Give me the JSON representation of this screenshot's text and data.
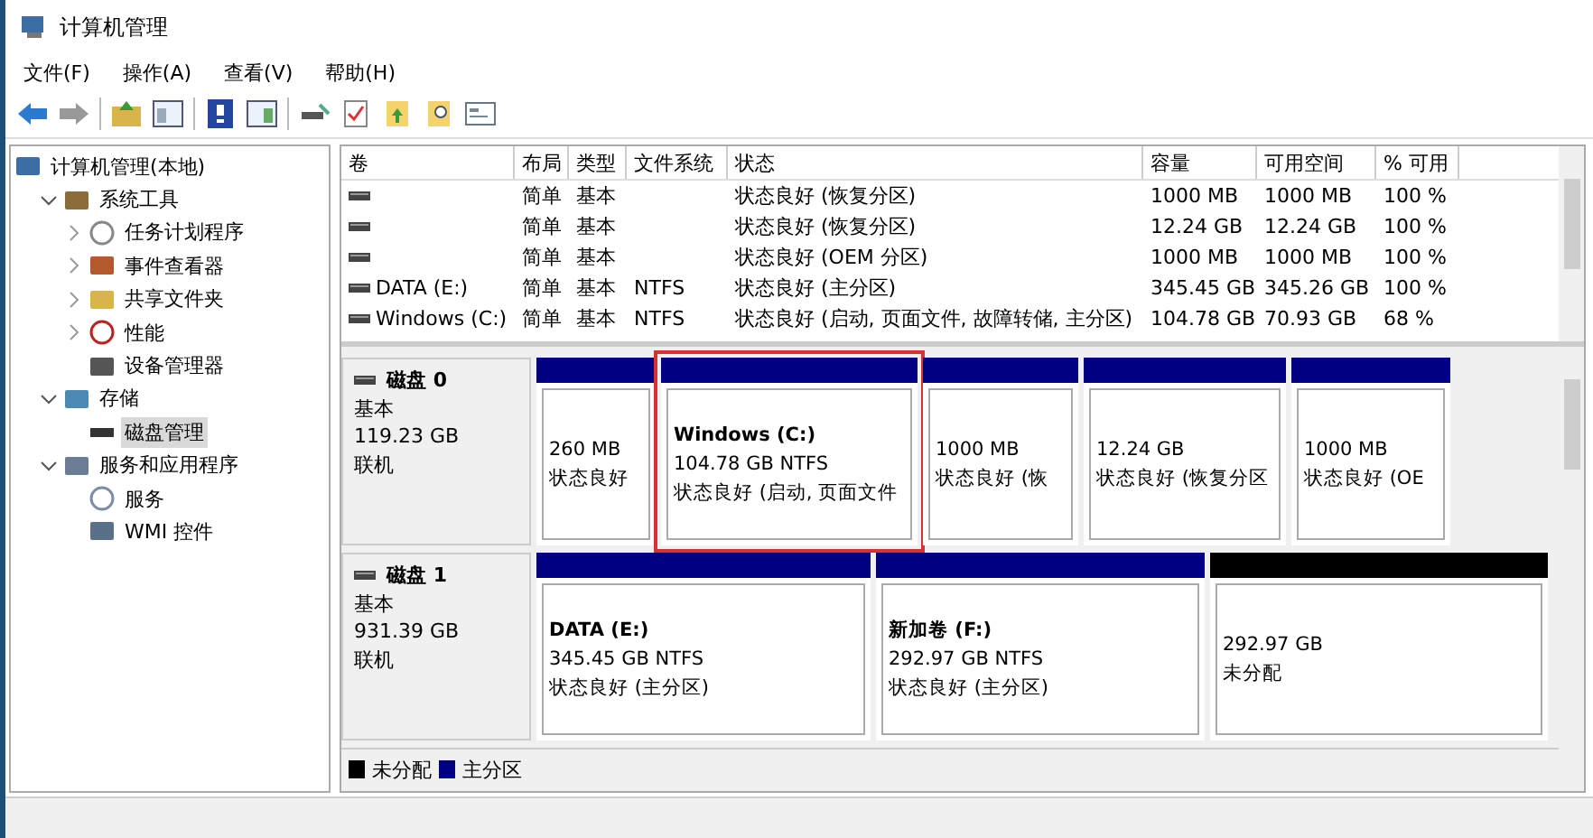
{
  "window": {
    "title": "计算机管理"
  },
  "menu": [
    "文件(F)",
    "操作(A)",
    "查看(V)",
    "帮助(H)"
  ],
  "tree": [
    {
      "label": "计算机管理(本地)",
      "selected": false,
      "children": [
        {
          "label": "系统工具",
          "expanded": true,
          "selected": false,
          "children": [
            {
              "label": "任务计划程序",
              "expanded": false,
              "selected": false
            },
            {
              "label": "事件查看器",
              "expanded": false,
              "selected": false
            },
            {
              "label": "共享文件夹",
              "expanded": false,
              "selected": false
            },
            {
              "label": "性能",
              "expanded": false,
              "selected": false
            },
            {
              "label": "设备管理器",
              "selected": false
            }
          ]
        },
        {
          "label": "存储",
          "expanded": true,
          "selected": false,
          "children": [
            {
              "label": "磁盘管理",
              "selected": true
            }
          ]
        },
        {
          "label": "服务和应用程序",
          "expanded": true,
          "selected": false,
          "children": [
            {
              "label": "服务",
              "selected": false
            },
            {
              "label": "WMI 控件",
              "selected": false
            }
          ]
        }
      ]
    }
  ],
  "table": {
    "columns": [
      "卷",
      "布局",
      "类型",
      "文件系统",
      "状态",
      "容量",
      "可用空间",
      "% 可用"
    ],
    "rows": [
      [
        "",
        "简单",
        "基本",
        "",
        "状态良好 (恢复分区)",
        "1000 MB",
        "1000 MB",
        "100 %"
      ],
      [
        "",
        "简单",
        "基本",
        "",
        "状态良好 (恢复分区)",
        "12.24 GB",
        "12.24 GB",
        "100 %"
      ],
      [
        "",
        "简单",
        "基本",
        "",
        "状态良好 (OEM 分区)",
        "1000 MB",
        "1000 MB",
        "100 %"
      ],
      [
        "DATA (E:)",
        "简单",
        "基本",
        "NTFS",
        "状态良好 (主分区)",
        "345.45 GB",
        "345.26 GB",
        "100 %"
      ],
      [
        "Windows (C:)",
        "简单",
        "基本",
        "NTFS",
        "状态良好 (启动, 页面文件, 故障转储, 主分区)",
        "104.78 GB",
        "70.93 GB",
        "68 %"
      ]
    ]
  },
  "disks": [
    {
      "name": "磁盘 0",
      "type": "基本",
      "size": "119.23 GB",
      "status": "联机",
      "partitions": [
        {
          "kind": "primary",
          "size": "260 MB",
          "status": "状态良好",
          "highlighted": false
        },
        {
          "kind": "primary",
          "name": "Windows  (C:)",
          "size": "104.78 GB NTFS",
          "status": "状态良好 (启动, 页面文件",
          "highlighted": true
        },
        {
          "kind": "primary",
          "size": "1000 MB",
          "status": "状态良好 (恢",
          "highlighted": false
        },
        {
          "kind": "primary",
          "size": "12.24 GB",
          "status": "状态良好 (恢复分区",
          "highlighted": false
        },
        {
          "kind": "primary",
          "size": "1000 MB",
          "status": "状态良好 (OE",
          "highlighted": false
        }
      ]
    },
    {
      "name": "磁盘 1",
      "type": "基本",
      "size": "931.39 GB",
      "status": "联机",
      "partitions": [
        {
          "kind": "primary",
          "name": "DATA  (E:)",
          "size": "345.45 GB NTFS",
          "status": "状态良好 (主分区)",
          "highlighted": false
        },
        {
          "kind": "primary",
          "name": "新加卷  (F:)",
          "size": "292.97 GB NTFS",
          "status": "状态良好 (主分区)",
          "highlighted": false
        },
        {
          "kind": "unallocated",
          "size": "292.97 GB",
          "status": "未分配",
          "highlighted": false
        }
      ]
    }
  ],
  "legend": [
    {
      "kind": "unallocated",
      "label": "未分配"
    },
    {
      "kind": "primary",
      "label": "主分区"
    }
  ]
}
